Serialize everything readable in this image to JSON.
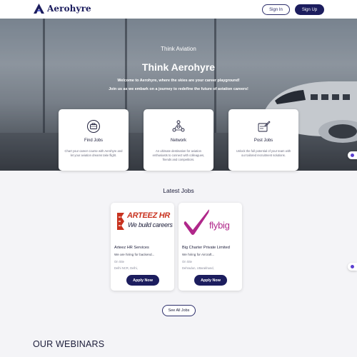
{
  "header": {
    "brand": "Aerohyre",
    "signin_label": "Sign In",
    "signup_label": "Sign Up"
  },
  "hero": {
    "kicker": "Think Aviation",
    "title": "Think Aerohyre",
    "line1": "Welcome to Aerohyre, where the skies are your career playground!",
    "line2": "Join us as we embark on a journey to redefine the future of aviation careers!"
  },
  "features": [
    {
      "title": "Find Jobs",
      "icon": "briefcase-search-icon",
      "desc": "Chart your career course with Aerohyre and let your aviation dreams take flight."
    },
    {
      "title": "Network",
      "icon": "network-icon",
      "desc": "An ultimate destination for aviation enthusiasts to connect with colleagues, friends and competitors."
    },
    {
      "title": "Post Jobs",
      "icon": "post-job-icon",
      "desc": "Unlock the full potential of your team with our tailored recruitment solutions."
    }
  ],
  "latest_jobs": {
    "title": "Latest Jobs",
    "jobs": [
      {
        "logo_line1": "ARTEEZ HR",
        "logo_line2": "We build careers",
        "company": "Arteez HR Services",
        "title": "We are hiring for backend...",
        "site": "On Site",
        "location": "Delhi NCR, Delhi,",
        "apply_label": "Apply Now"
      },
      {
        "logo_text": "flybig",
        "company": "Big Charter Private Limited",
        "title": "We hiring for Aircraft...",
        "site": "On Site",
        "location": "Dehradun, Uttarakhand,",
        "apply_label": "Apply Now"
      }
    ],
    "see_all_label": "See All Jobs"
  },
  "webinars": {
    "title": "OUR WEBINARS"
  },
  "colors": {
    "brand": "#1c1d5e",
    "accent_purple": "#5b3fd0",
    "arteez_red": "#c8321f",
    "flybig_pink": "#b0278a"
  }
}
